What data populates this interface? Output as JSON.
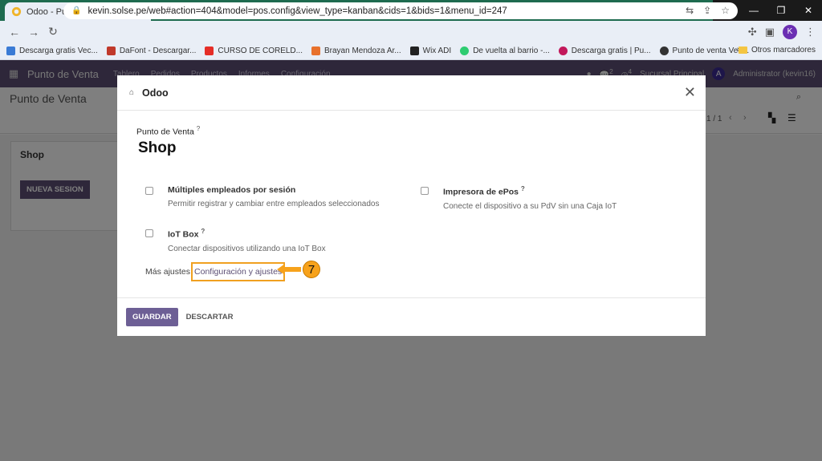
{
  "browser": {
    "tab_title": "Odoo - Punto de Venta",
    "tab_close": "✕",
    "new_tab": "+",
    "url": "kevin.solse.pe/web#action=404&model=pos.config&view_type=kanban&cids=1&bids=1&menu_id=247",
    "profile_initial": "K",
    "bookmarks": [
      {
        "label": "Descarga gratis Vec...",
        "color": "#3a7bd5"
      },
      {
        "label": "DaFont - Descargar...",
        "color": "#c0392b"
      },
      {
        "label": "CURSO DE CORELD...",
        "color": "#e52d27"
      },
      {
        "label": "Brayan Mendoza Ar...",
        "color": "#e8712c"
      },
      {
        "label": "Wix ADI",
        "color": "#222222"
      },
      {
        "label": "De vuelta al barrio -...",
        "color": "#2ecc71"
      },
      {
        "label": "Descarga gratis | Pu...",
        "color": "#c2185b"
      },
      {
        "label": "Punto de venta Ven...",
        "color": "#333333"
      }
    ],
    "bookmarks_more": "»",
    "other_bookmarks": "Otros marcadores"
  },
  "odoo": {
    "app_name": "Punto de Venta",
    "menus": [
      "Tablero",
      "Pedidos",
      "Productos",
      "Informes",
      "Configuración"
    ],
    "badge_messages": "2",
    "badge_activities": "4",
    "branch": "Sucursal Principal",
    "user_initial": "A",
    "user": "Administrator (kevin16)",
    "breadcrumb": "Punto de Venta",
    "pager": "1 / 1",
    "card_name": "Shop",
    "new_session": "NUEVA SESION"
  },
  "modal": {
    "title": "Odoo",
    "field_label": "Punto de Venta",
    "help_mark": "?",
    "record_name": "Shop",
    "options": [
      {
        "title": "Múltiples empleados por sesión",
        "desc": "Permitir registrar y cambiar entre empleados seleccionados",
        "help": ""
      },
      {
        "title": "Impresora de ePos",
        "desc": "Conecte el dispositivo a su PdV sin una Caja IoT",
        "help": "?"
      },
      {
        "title": "IoT Box",
        "desc": "Conectar dispositivos utilizando una IoT Box",
        "help": "?"
      }
    ],
    "more_settings": "Más ajustes",
    "settings_link": "Configuración y ajustes",
    "step_number": "7",
    "save": "GUARDAR",
    "discard": "DESCARTAR"
  },
  "colors": {
    "odoo_purple": "#5c4f75",
    "highlight": "#f0a020",
    "callout": "#f7a21b"
  }
}
